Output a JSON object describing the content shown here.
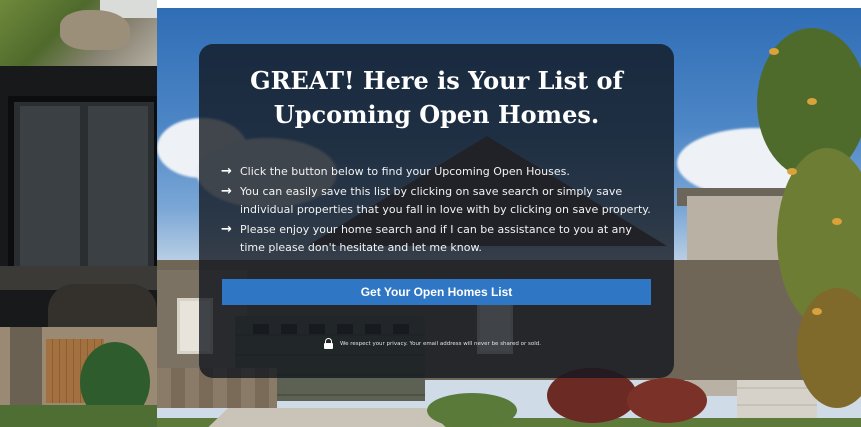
{
  "card": {
    "headline_line1": "GREAT! Here is Your List of",
    "headline_line2": "Upcoming Open Homes.",
    "bullets": [
      {
        "text": "Click the button below to find your Upcoming Open Houses.",
        "icon": "arrow-right-icon"
      },
      {
        "text": "You can easily save this list by clicking on save search or simply save individual properties that you fall in love with by clicking on save property.",
        "icon": "arrow-right-icon"
      },
      {
        "text": "Please enjoy your home search and if I can be assistance to you at any time please don't hesitate and let me know.",
        "icon": "arrow-right-icon"
      }
    ],
    "cta_label": "Get Your Open Homes List",
    "privacy_text": "We respect your privacy. Your email address will never be shared or sold."
  },
  "colors": {
    "card_background": "#11161e",
    "cta_background": "#2f76c4",
    "text": "#ffffff"
  },
  "icons": {
    "bullet": "arrow-right-icon",
    "privacy": "lock-icon"
  }
}
